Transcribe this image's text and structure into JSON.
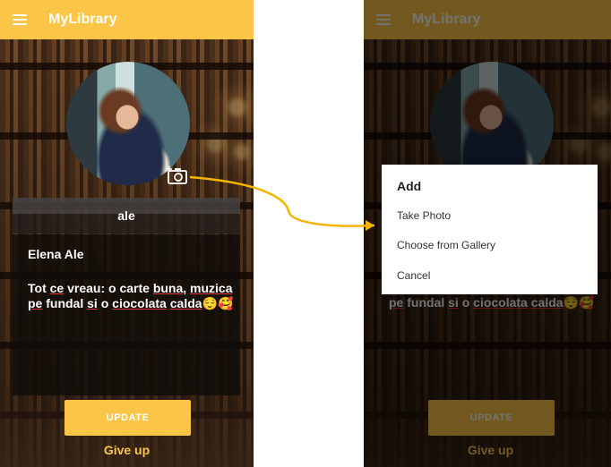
{
  "app": {
    "title": "MyLibrary"
  },
  "profile": {
    "username": "ale",
    "full_name": "Elena Ale",
    "bio_line1_plain": "Tot ",
    "bio_line1_u1": "ce",
    "bio_line1_mid": " vreau: o carte ",
    "bio_line1_u2": "buna",
    "bio_line1_end": ", ",
    "bio_line1_u3": "muzica",
    "bio_line2_u1": "pe",
    "bio_line2_mid": " fundal ",
    "bio_line2_u2": "si",
    "bio_line2_mid2": " o ",
    "bio_line2_u3": "ciocolata",
    "bio_line2_u4": "calda",
    "bio_emoji": "😌🥰"
  },
  "buttons": {
    "update": "UPDATE",
    "give_up": "Give up"
  },
  "dialog": {
    "title": "Add",
    "options": [
      "Take Photo",
      "Choose from Gallery",
      "Cancel"
    ]
  },
  "colors": {
    "accent": "#fbc547",
    "arrow": "#f5b400"
  }
}
